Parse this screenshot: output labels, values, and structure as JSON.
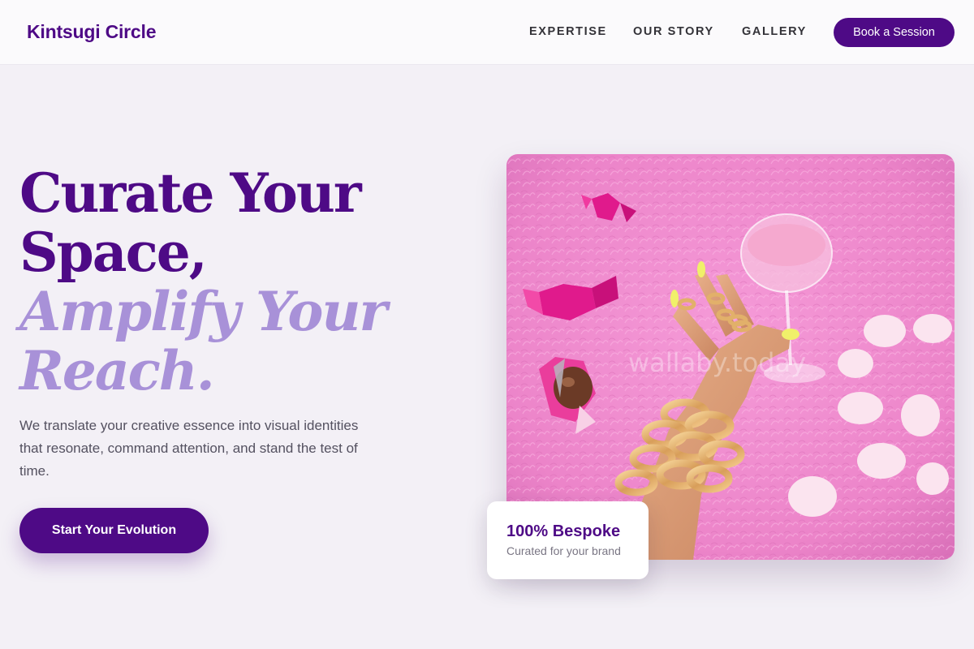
{
  "header": {
    "brand": "Kintsugi Circle",
    "nav": [
      "EXPERTISE",
      "OUR STORY",
      "GALLERY"
    ],
    "cta": "Book a Session"
  },
  "hero": {
    "title_line1": "Curate Your",
    "title_line2": "Space,",
    "title_accent1": "Amplify Your",
    "title_accent2": "Reach.",
    "description": "We translate your creative essence into visual identities that resonate, command attention, and stand the test of time.",
    "cta": "Start Your Evolution"
  },
  "image": {
    "watermark": "wallaby.today"
  },
  "stat_card": {
    "value": "100% Bespoke",
    "label": "Curated for your brand"
  },
  "colors": {
    "brand": "#4e0a86",
    "accent": "#a891d8",
    "background": "#f3f0f6",
    "image_base": "#f08ad0"
  }
}
